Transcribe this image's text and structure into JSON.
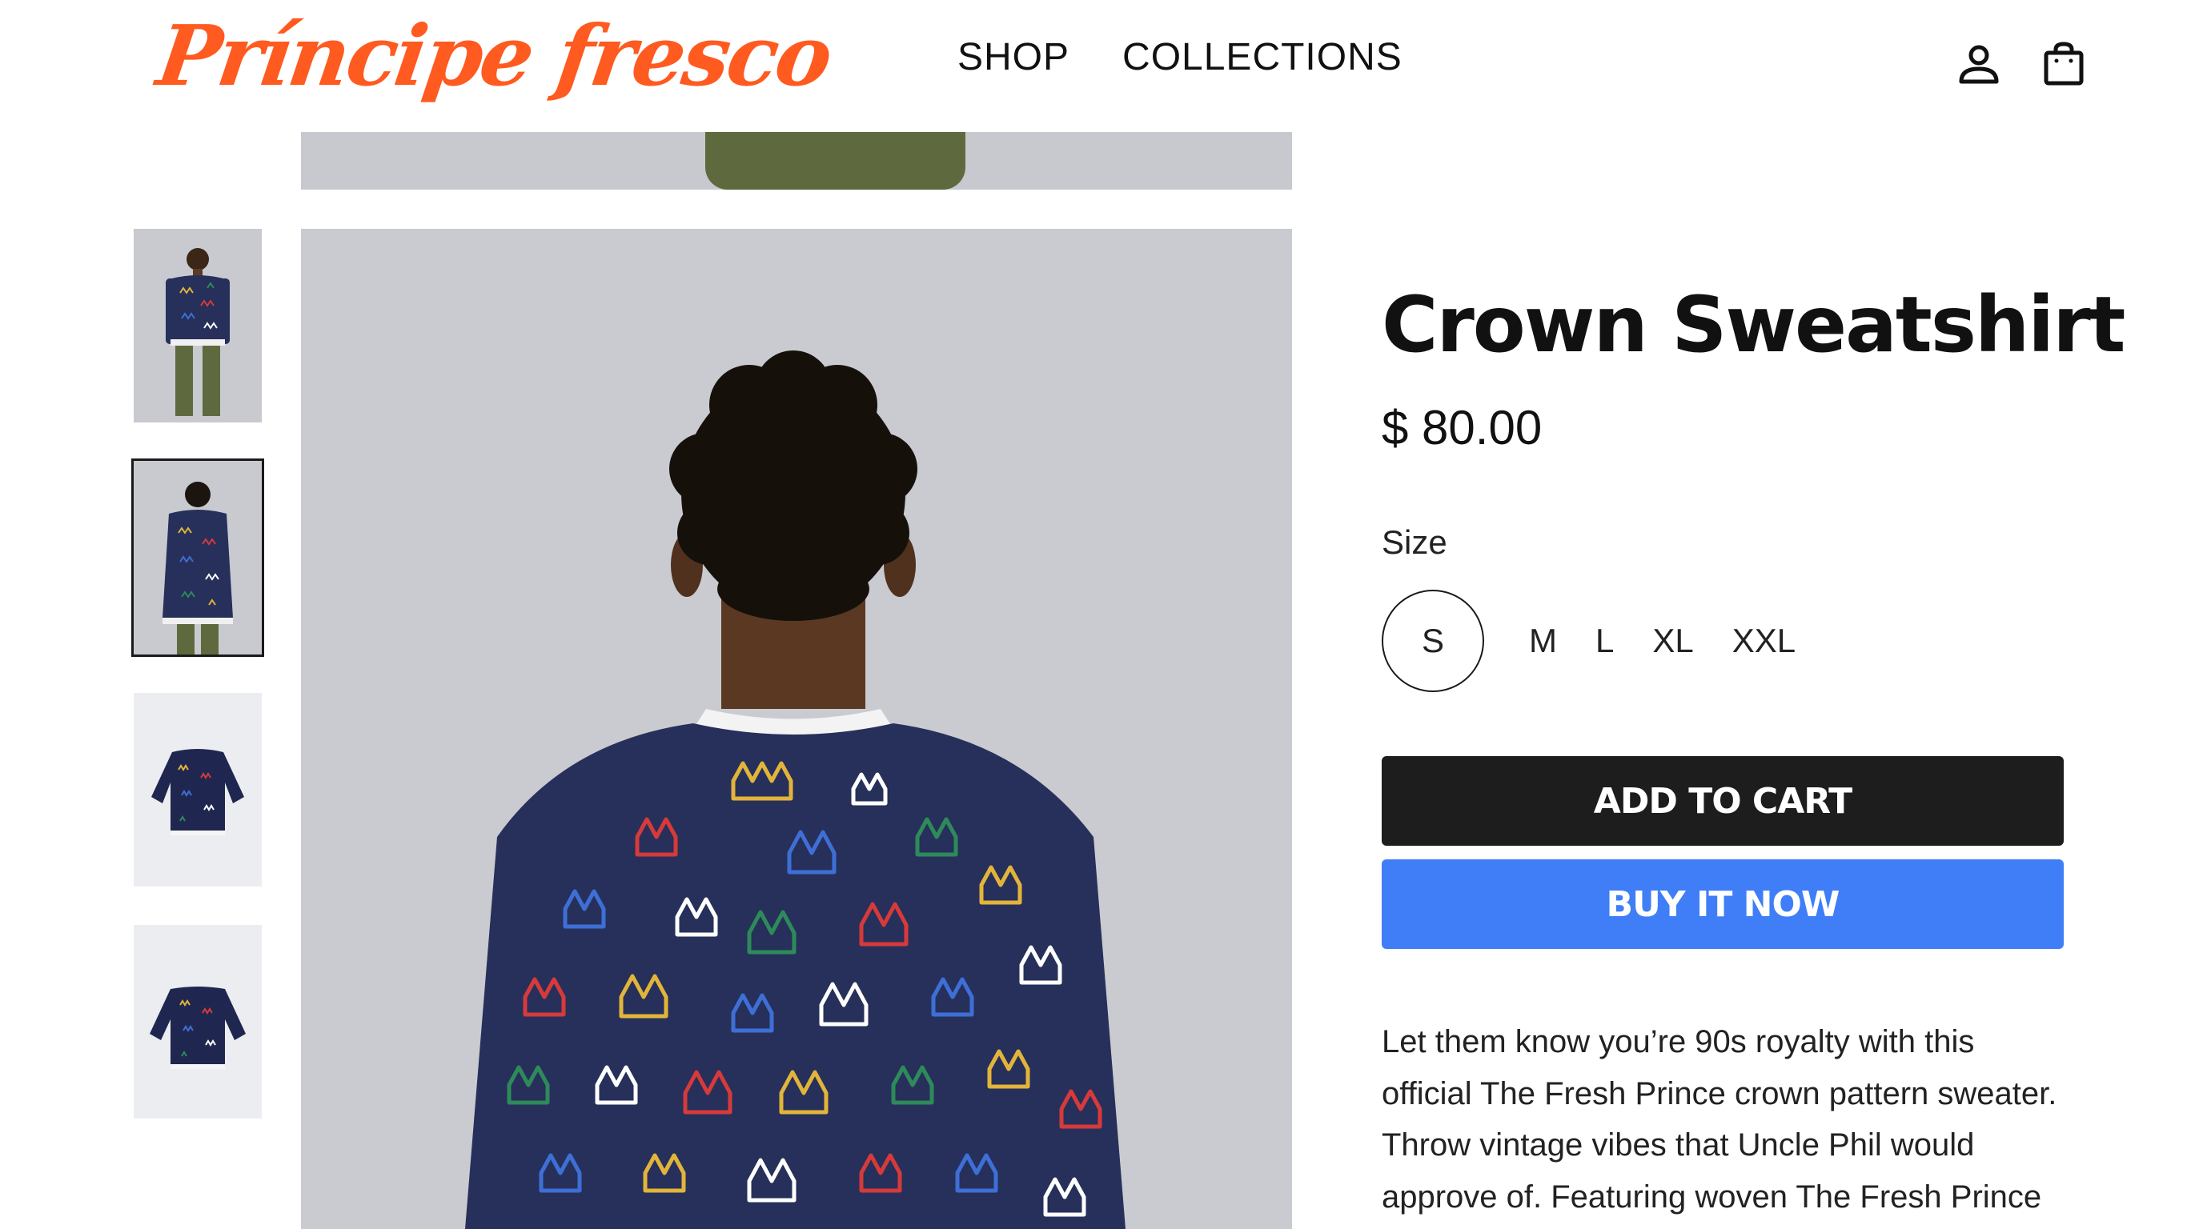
{
  "brand": {
    "logo_text": "Príncipe fresco",
    "color": "#ff5a1f"
  },
  "nav": {
    "items": [
      {
        "label": "SHOP"
      },
      {
        "label": "COLLECTIONS"
      }
    ]
  },
  "header_icons": {
    "account": "account-icon",
    "cart": "cart-bag-icon"
  },
  "gallery": {
    "thumbnails": [
      {
        "alt": "model-front-view",
        "selected": false
      },
      {
        "alt": "model-back-view",
        "selected": true
      },
      {
        "alt": "sweatshirt-flat-front",
        "selected": false
      },
      {
        "alt": "sweatshirt-flat-back",
        "selected": false
      }
    ],
    "main_image": "model-back-view-wearing-crown-sweatshirt"
  },
  "product": {
    "title": "Crown Sweatshirt",
    "price": "$ 80.00",
    "size_label": "Size",
    "sizes": [
      "S",
      "M",
      "L",
      "XL",
      "XXL"
    ],
    "selected_size": "S",
    "add_to_cart_label": "ADD TO CART",
    "buy_now_label": "BUY IT NOW",
    "description": "Let them know you’re 90s royalty with this official The Fresh Prince crown pattern sweater. Throw vintage vibes that Uncle Phil would approve of. Featuring woven The Fresh Prince"
  },
  "colors": {
    "add_to_cart_bg": "#1d1d1d",
    "buy_now_bg": "#3f7ef7",
    "sweater_navy": "#26305a"
  }
}
